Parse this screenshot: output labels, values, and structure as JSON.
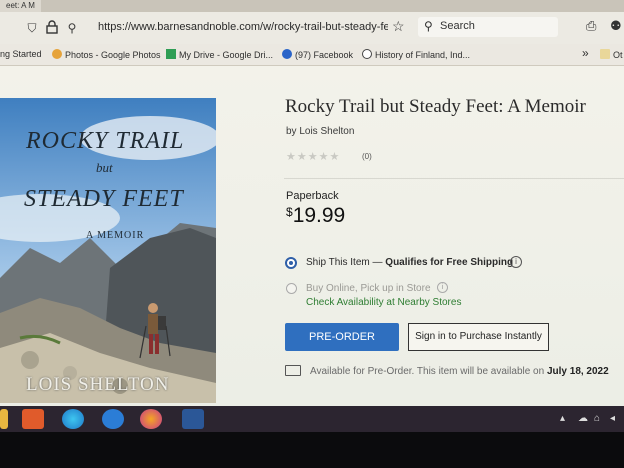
{
  "browser": {
    "tab_title": "eet: A M",
    "url": "https://www.barnesandnoble.com/w/rocky-trail-but-steady-feet",
    "search_placeholder": "Search",
    "bookmarks": [
      {
        "label": "ng Started",
        "color": "#ffffff"
      },
      {
        "label": "Photos - Google Photos",
        "color": "#e6a33a"
      },
      {
        "label": "My Drive - Google Dri...",
        "color": "#2f9e55"
      },
      {
        "label": "(97) Facebook",
        "color": "#2a64c8"
      },
      {
        "label": "History of Finland, Ind...",
        "color": "#444444"
      }
    ],
    "overflow_label": "»",
    "other_label": "Ot"
  },
  "product": {
    "title": "Rocky Trail but Steady Feet: A Memoir",
    "byline": "by Lois Shelton",
    "rating_stars": "★★★★★",
    "review_count": "(0)",
    "format": "Paperback",
    "price_symbol": "$",
    "price_value": "19.99",
    "ship_option": "Ship This Item —",
    "ship_qualifier": "Qualifies for Free Shipping",
    "pickup_option": "Buy Online, Pick up in Store",
    "check_link": "Check Availability at Nearby Stores",
    "preorder_button": "PRE-ORDER",
    "signin_button": "Sign in to Purchase Instantly",
    "availability_text": "Available for Pre-Order. This item will be available on",
    "availability_date": "July 18, 2022",
    "info_glyph": "i"
  },
  "cover": {
    "title_line1": "ROCKY TRAIL",
    "title_but": "but",
    "title_line2": "STEADY FEET",
    "subtitle": "A MEMOIR",
    "author": "LOIS SHELTON"
  },
  "colors": {
    "accent_blue": "#2f6fbf",
    "link_green": "#2e7d32"
  }
}
